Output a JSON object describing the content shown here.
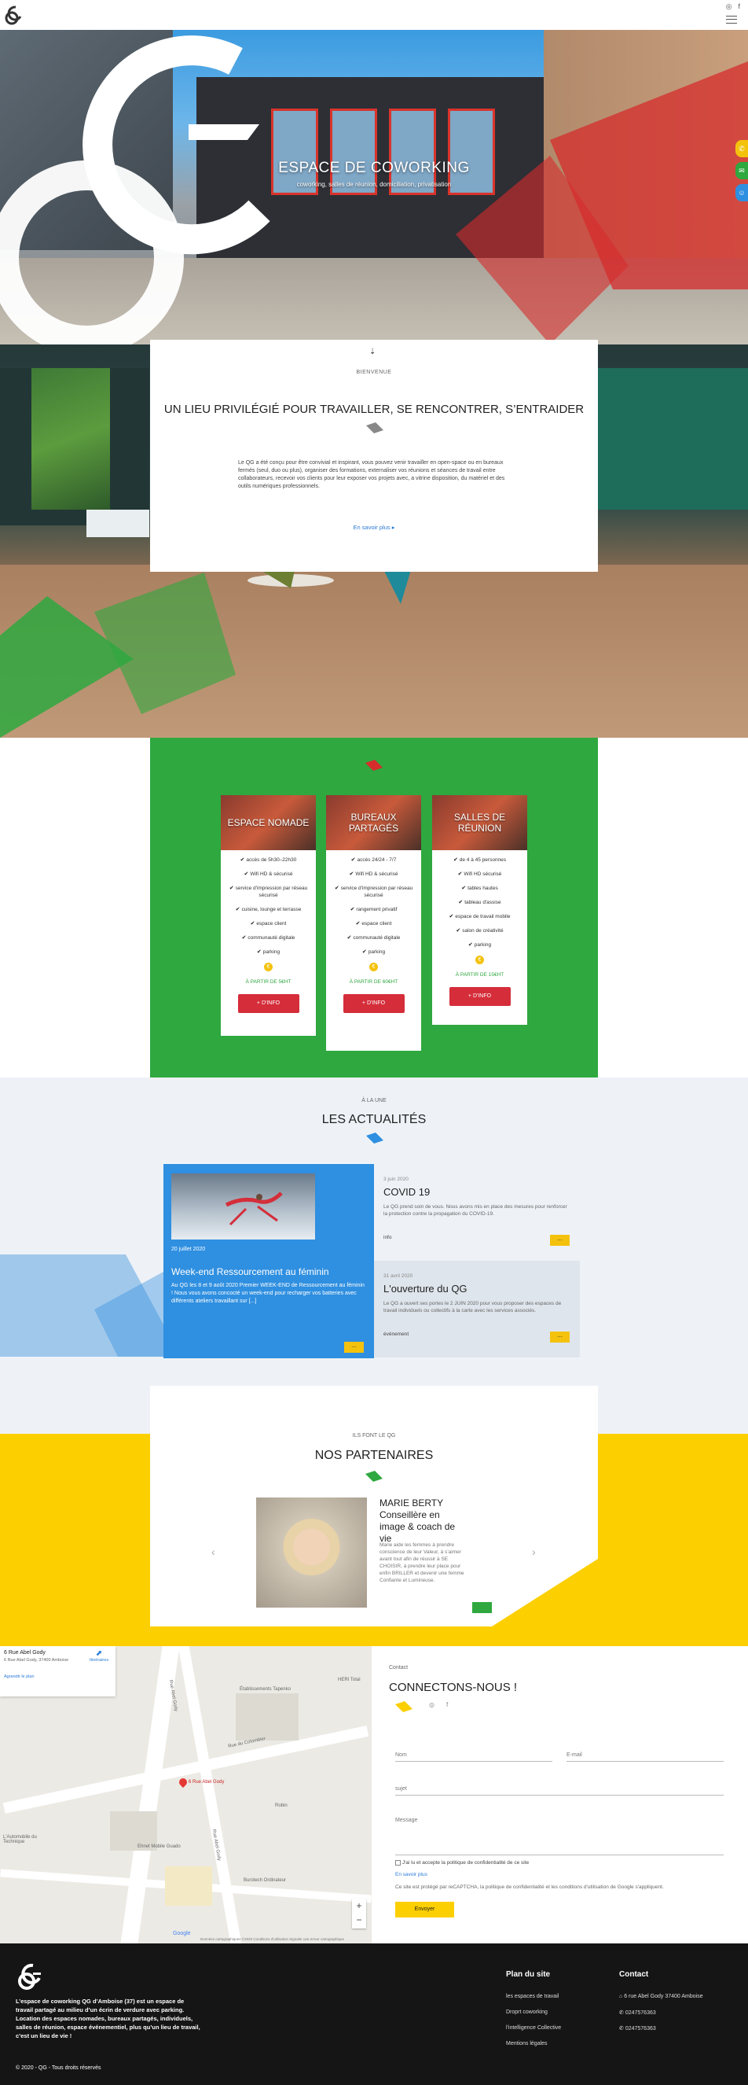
{
  "header": {
    "social": [
      "instagram-icon",
      "facebook-icon"
    ]
  },
  "hero": {
    "title": "ESPACE DE COWORKING",
    "subtitle": "coworking, salles de réunion, domiciliation, privatisation"
  },
  "welcome": {
    "kicker": "BIENVENUE",
    "title": "UN LIEU PRIVILÉGIÉ POUR TRAVAILLER, SE RENCONTRER, S’ENTRAIDER",
    "text": "Le QG a été conçu pour être convivial et inspirant, vous pouvez venir travailler en open-space ou en bureaux fermés (seul, duo ou plus), organiser des formations, externaliser vos réunions et séances de travail entre collaborateurs, recevoir vos clients pour leur exposer vos projets avec, a vitrine disposition, du matériel et des outils numériques professionnels.",
    "link": "En savoir plus ▸"
  },
  "offers": [
    {
      "title": "ESPACE NOMADE",
      "features": [
        "accès de 5h30–22h30",
        "Wifi HD & sécurisé",
        "service d'impression par réseau sécurisé",
        "cuisine, lounge et terrasse",
        "espace client",
        "communauté digitale",
        "parking"
      ],
      "price": "À PARTIR DE 5€HT",
      "button": "+ D'INFO"
    },
    {
      "title": "BUREAUX PARTAGÉS",
      "features": [
        "accès 24/24 - 7/7",
        "Wifi HD & sécurisé",
        "service d'impression par réseau sécurisé",
        "rangement privatif",
        "espace client",
        "communauté digitale",
        "parking"
      ],
      "price": "À PARTIR DE 60€HT",
      "button": "+ D'INFO"
    },
    {
      "title": "SALLES DE RÉUNION",
      "features": [
        "de 4 à 45 personnes",
        "Wifi HD sécurisé",
        "tables hautes",
        "tableau d'assise",
        "espace de travail mobile",
        "salon de créativité",
        "parking"
      ],
      "price": "À PARTIR DE 15€HT",
      "button": "+ D'INFO"
    }
  ],
  "news": {
    "kicker": "À LA UNE",
    "title": "LES ACTUALITÉS",
    "featured": {
      "date": "20 juillet 2020",
      "title": "Week-end Ressourcement au féminin",
      "text": "Au QG les 8 et 9 août 2020 Premier WEEK-END de Ressourcement au féminin ! Nous vous avons concocté un week-end pour recharger vos batteries avec différents ateliers travaillant sur [...]",
      "button": "..."
    },
    "items": [
      {
        "date": "3 juin 2020",
        "title": "COVID 19",
        "text": "Le QG prend soin de vous. Nous avons mis en place des mesures pour renforcer la protection contre la propagation du COVID-19.",
        "category": "info",
        "button": "..."
      },
      {
        "date": "31 avril 2020",
        "title": "L'ouverture du QG",
        "text": "Le QG a ouvert ses portes le 2 JUIN 2020 pour vous proposer des espaces de travail individuels ou collectifs à la carte avec les services associés.",
        "category": "événement",
        "button": "..."
      }
    ]
  },
  "partners": {
    "kicker": "ILS FONT LE QG",
    "title": "NOS PARTENAIRES",
    "name": "MARIE BERTY\nConseillère en image & coach de vie",
    "description": "Marie aide les femmes à prendre conscience de leur Valeur, à s’aimer avant tout afin de réussir à SE CHOISIR, à prendre leur place pour enfin BRILLER et devenir une femme Confiante et Lumineuse."
  },
  "map": {
    "place_title": "6 Rue Abel Gody",
    "place_address": "6 Rue Abel Gody, 37400 Amboise",
    "directions": "Itinéraires",
    "larger_map": "Agrandir le plan",
    "pin_label": "6 Rue Abel Gody",
    "labels": [
      "Établissements Tapenko",
      "Rue du Colombier",
      "Rue Abel Gody",
      "Rue Abel Gody",
      "HERI Total",
      "Robin",
      "Ehnet Mobile Guado",
      "Burotech Ordinateur",
      "L'Automobile du Technique"
    ],
    "footer": "Données cartographiques ©2020   Conditions d'utilisation   Signaler une erreur cartographique"
  },
  "contact": {
    "kicker": "Contact",
    "title": "CONNECTONS-NOUS !",
    "name_label": "Nom",
    "email_label": "E-mail",
    "subject_label": "sujet",
    "message_label": "Message",
    "consent": "J'ai lu et accepte la politique de confidentialité de ce site",
    "more": "En savoir plus",
    "recaptcha": "Ce site est protégé par reCAPTCHA, la politique de confidentialité et les conditions d'utilisation de Google s'appliquent.",
    "submit": "Envoyer"
  },
  "footer": {
    "description": "L’espace de coworking QG d’Amboise (37) est un espace de travail partagé au milieu d’un écrin de verdure avec parking. Location des espaces nomades, bureaux partagés, individuels, salles de réunion, espace événementiel, plus qu’un lieu de travail, c’est un lieu de vie !",
    "copyright": "© 2020 - QG - Tous droits réservés",
    "sitemap_title": "Plan du site",
    "sitemap": [
      "les espaces de travail",
      "Droprt coworking",
      "l'intelligence Collective",
      "Mentions légales"
    ],
    "contact_title": "Contact",
    "contact_items": [
      "6 rue Abel Gody 37400 Amboise",
      "0247576363",
      "0247576363"
    ]
  }
}
